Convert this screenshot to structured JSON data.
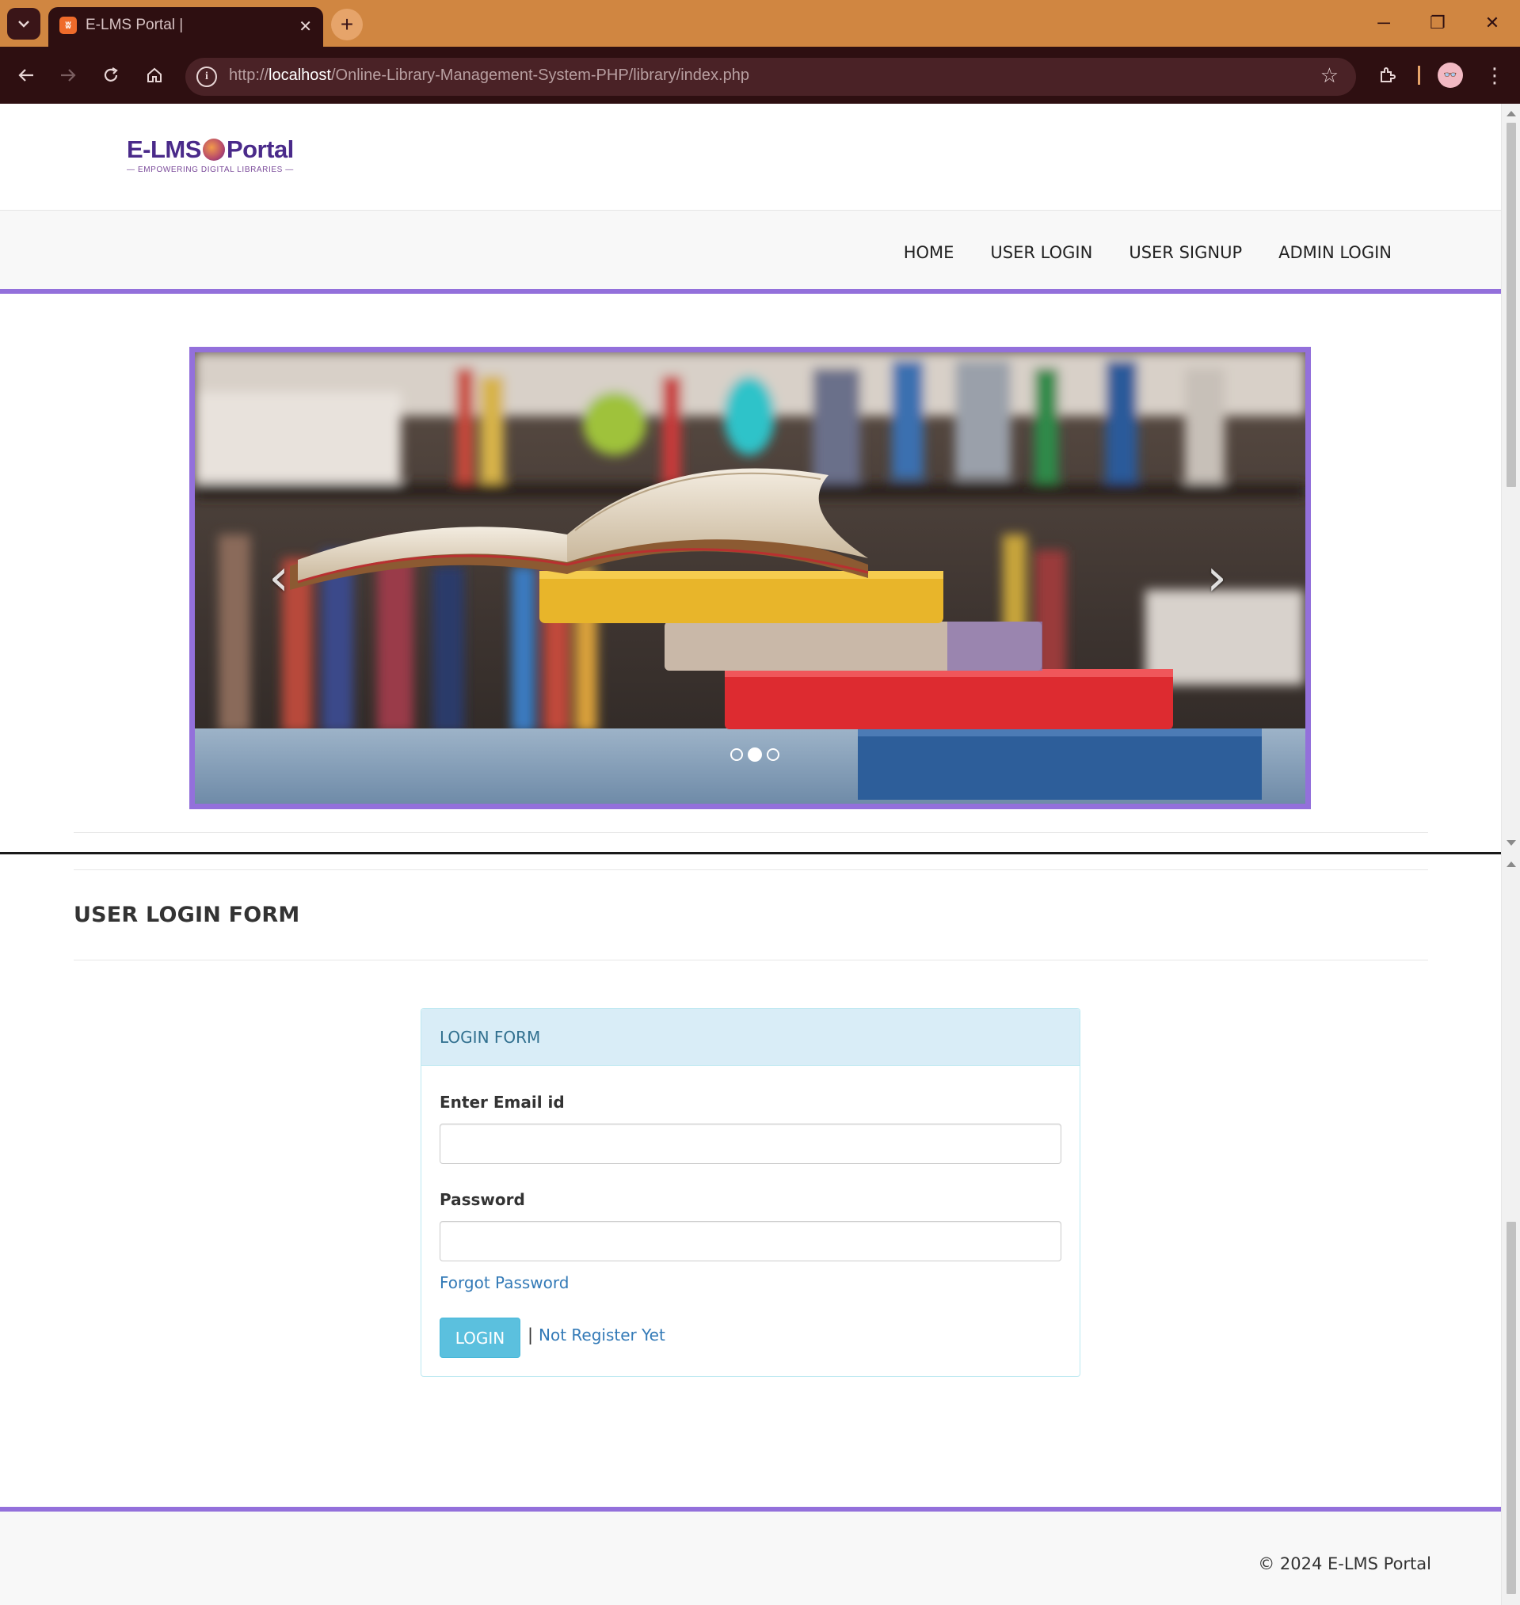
{
  "browser": {
    "tab_title": "E-LMS Portal |",
    "tab_close": "✕",
    "new_tab": "+",
    "url_prefix": "http://",
    "url_host": "localhost",
    "url_path": "/Online-Library-Management-System-PHP/library/index.php",
    "window_controls": [
      "─",
      "❐",
      "✕"
    ],
    "icons": [
      "tab-search-icon",
      "back-icon",
      "forward-icon",
      "reload-icon",
      "home-icon",
      "site-info-icon",
      "bookmark-star-icon",
      "extensions-icon",
      "profile-icon",
      "menu-icon"
    ]
  },
  "site": {
    "logo_text_left": "E-LMS",
    "logo_text_right": "Portal",
    "logo_tagline": "— EMPOWERING DIGITAL LIBRARIES —",
    "nav": [
      "HOME",
      "USER LOGIN",
      "USER SIGNUP",
      "ADMIN LOGIN"
    ],
    "accent_color": "#9370db"
  },
  "carousel": {
    "slide_count": 3,
    "active_slide": 2,
    "prev_glyph": "‹",
    "next_glyph": "›"
  },
  "login": {
    "page_heading": "USER LOGIN FORM",
    "panel_title": "LOGIN FORM",
    "email_label": "Enter Email id",
    "email_value": "",
    "password_label": "Password",
    "password_value": "",
    "forgot_link": "Forgot Password",
    "login_button": "LOGIN",
    "separator": "|",
    "register_link": "Not Register Yet"
  },
  "footer": {
    "copyright": "© 2024 E-LMS Portal"
  }
}
